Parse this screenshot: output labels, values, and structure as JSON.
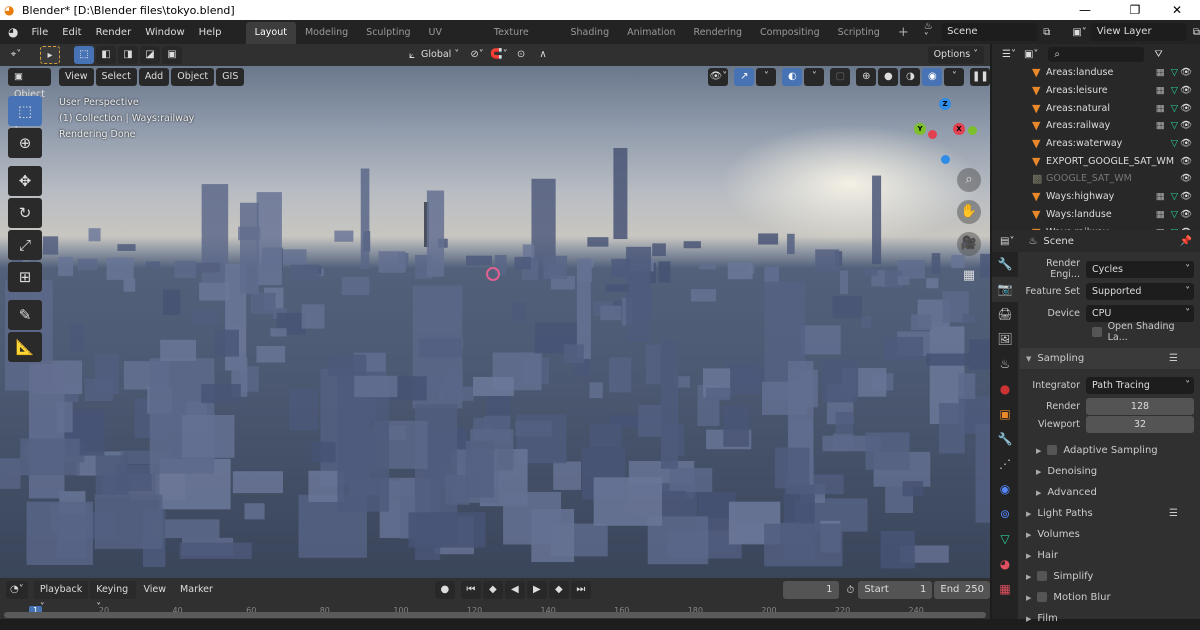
{
  "window": {
    "title": "Blender* [D:\\Blender files\\tokyo.blend]",
    "minimize": "—",
    "maximize": "❐",
    "close": "✕"
  },
  "menu": [
    "File",
    "Edit",
    "Render",
    "Window",
    "Help"
  ],
  "workspaces": [
    "Layout",
    "Modeling",
    "Sculpting",
    "UV Editing",
    "Texture Paint",
    "Shading",
    "Animation",
    "Rendering",
    "Compositing",
    "Scripting"
  ],
  "active_workspace": "Layout",
  "add_workspace": "+",
  "scene": {
    "name": "Scene",
    "view_layer": "View Layer"
  },
  "tool_header": {
    "orientation": "Global",
    "options": "Options"
  },
  "viewport_header": {
    "mode": "Object Mode",
    "menus": [
      "View",
      "Select",
      "Add",
      "Object",
      "GIS"
    ]
  },
  "overlay_text": {
    "perspective": "User Perspective",
    "collection": "(1) Collection | Ways:railway",
    "status": "Rendering Done"
  },
  "gizmo": {
    "x": "X",
    "y": "Y",
    "z": "Z",
    "colors": {
      "x": "#e0404f",
      "y": "#7ec02c",
      "z": "#2e8ce6"
    }
  },
  "outliner": {
    "search_placeholder": "",
    "items": [
      {
        "name": "Areas:landuse",
        "type": "mesh",
        "modifiers": true
      },
      {
        "name": "Areas:leisure",
        "type": "mesh",
        "modifiers": true
      },
      {
        "name": "Areas:natural",
        "type": "mesh",
        "modifiers": true
      },
      {
        "name": "Areas:railway",
        "type": "mesh",
        "modifiers": true
      },
      {
        "name": "Areas:waterway",
        "type": "mesh",
        "modifiers": false
      },
      {
        "name": "EXPORT_GOOGLE_SAT_WM",
        "type": "mesh",
        "modifiers": false
      },
      {
        "name": "GOOGLE_SAT_WM",
        "type": "image",
        "modifiers": false
      },
      {
        "name": "Ways:highway",
        "type": "mesh",
        "modifiers": true
      },
      {
        "name": "Ways:landuse",
        "type": "mesh",
        "modifiers": true
      },
      {
        "name": "Ways:railway",
        "type": "mesh",
        "modifiers": true
      }
    ]
  },
  "properties": {
    "context": "Scene",
    "render_engine_label": "Render Engi...",
    "render_engine": "Cycles",
    "feature_set_label": "Feature Set",
    "feature_set": "Supported",
    "device_label": "Device",
    "device": "CPU",
    "open_shading": "Open Shading La...",
    "sampling": "Sampling",
    "integrator_label": "Integrator",
    "integrator": "Path Tracing",
    "render_label": "Render",
    "render_samples": "128",
    "viewport_label": "Viewport",
    "viewport_samples": "32",
    "adaptive": "Adaptive Sampling",
    "denoising": "Denoising",
    "advanced": "Advanced",
    "panels": [
      "Light Paths",
      "Volumes",
      "Hair",
      "Simplify",
      "Motion Blur",
      "Film"
    ]
  },
  "timeline": {
    "menus": [
      "Playback",
      "Keying",
      "View",
      "Marker"
    ],
    "current_frame": "1",
    "start_label": "Start",
    "start": "1",
    "end_label": "End",
    "end": "250",
    "ticks": [
      "1",
      "20",
      "40",
      "60",
      "80",
      "100",
      "120",
      "140",
      "160",
      "180",
      "200",
      "220",
      "240"
    ]
  },
  "accent": "#4772b3"
}
